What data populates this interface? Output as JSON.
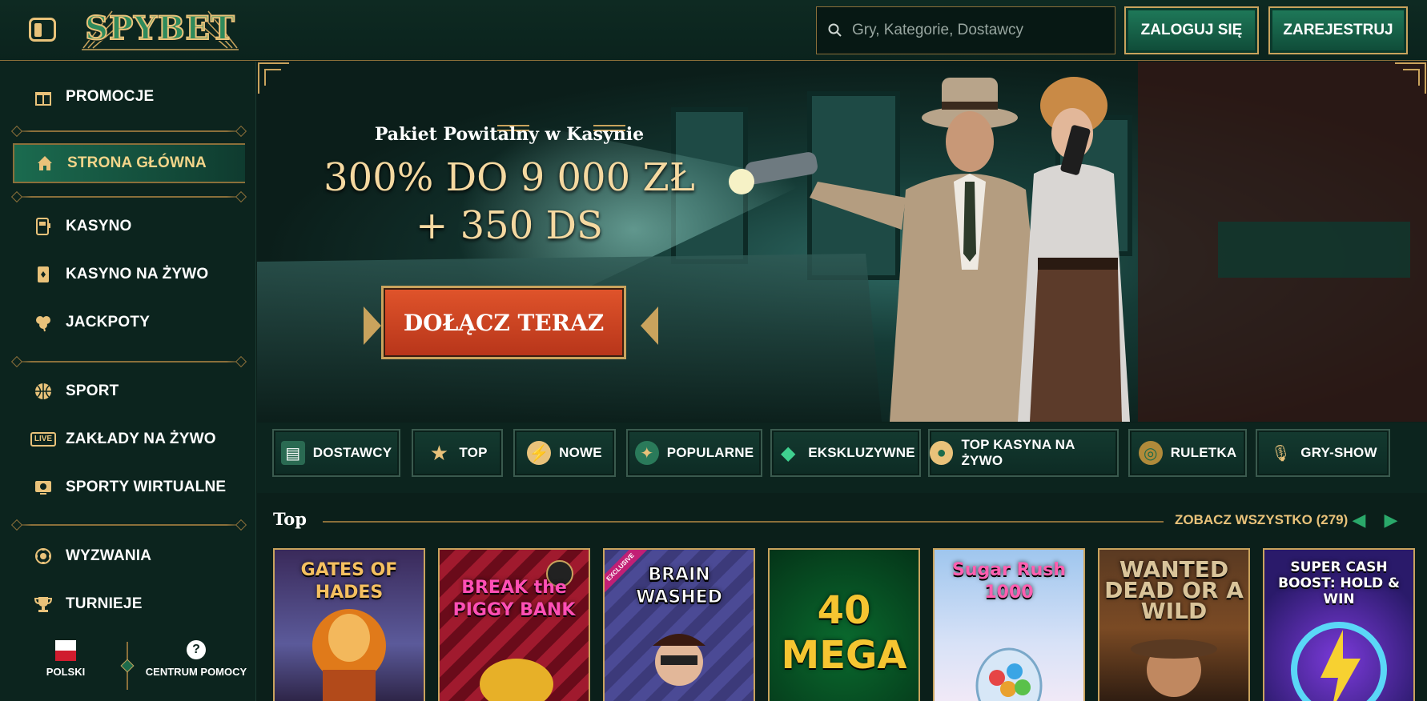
{
  "header": {
    "logo_text": "SPYBET",
    "search_placeholder": "Gry, Kategorie, Dostawcy",
    "login_label": "ZALOGUJ SIĘ",
    "register_label": "ZAREJESTRUJ"
  },
  "sidebar": {
    "items": [
      {
        "label": "PROMOCJE",
        "icon": "gift-icon"
      },
      {
        "label": "STRONA GŁÓWNA",
        "icon": "home-icon",
        "active": true
      },
      {
        "label": "KASYNO",
        "icon": "slot-machine-icon"
      },
      {
        "label": "KASYNO NA ŻYWO",
        "icon": "card-icon"
      },
      {
        "label": "JACKPOTY",
        "icon": "clover-icon"
      },
      {
        "label": "SPORT",
        "icon": "basketball-icon"
      },
      {
        "label": "ZAKŁADY NA ŻYWO",
        "icon": "live-icon"
      },
      {
        "label": "SPORTY WIRTUALNE",
        "icon": "monitor-ball-icon"
      },
      {
        "label": "WYZWANIA",
        "icon": "medal-icon"
      },
      {
        "label": "TURNIEJE",
        "icon": "trophy-icon"
      }
    ],
    "live_badge": "LIVE",
    "language_label": "POLSKI",
    "help_label": "CENTRUM POMOCY"
  },
  "banner": {
    "subtitle": "Pakiet Powitalny w Kasynie",
    "headline_1": "300% DO 9 000 ZŁ",
    "headline_2": "+ 350 DS",
    "cta_label": "DOŁĄCZ TERAZ"
  },
  "categories": [
    {
      "label": "DOSTAWCY",
      "icon": "providers-icon"
    },
    {
      "label": "TOP",
      "icon": "star-icon"
    },
    {
      "label": "NOWE",
      "icon": "lightning-icon"
    },
    {
      "label": "POPULARNE",
      "icon": "popular-icon"
    },
    {
      "label": "EKSKLUZYWNE",
      "icon": "diamond-icon"
    },
    {
      "label": "TOP KASYNA NA ŻYWO",
      "icon": "chip-icon"
    },
    {
      "label": "RULETKA",
      "icon": "roulette-icon"
    },
    {
      "label": "GRY-SHOW",
      "icon": "microphone-icon"
    }
  ],
  "top_section": {
    "title": "Top",
    "see_all_label": "ZOBACZ WSZYSTKO (279)"
  },
  "games": [
    {
      "title": "GATES OF HADES"
    },
    {
      "title": "BREAK the PIGGY BANK"
    },
    {
      "title": "BRAIN WASHED",
      "badge": "EXCLUSIVE"
    },
    {
      "title": "40 MEGA"
    },
    {
      "title": "Sugar Rush 1000"
    },
    {
      "title": "WANTED DEAD OR A WILD"
    },
    {
      "title": "SUPER CASH BOOST: HOLD & WIN"
    }
  ]
}
